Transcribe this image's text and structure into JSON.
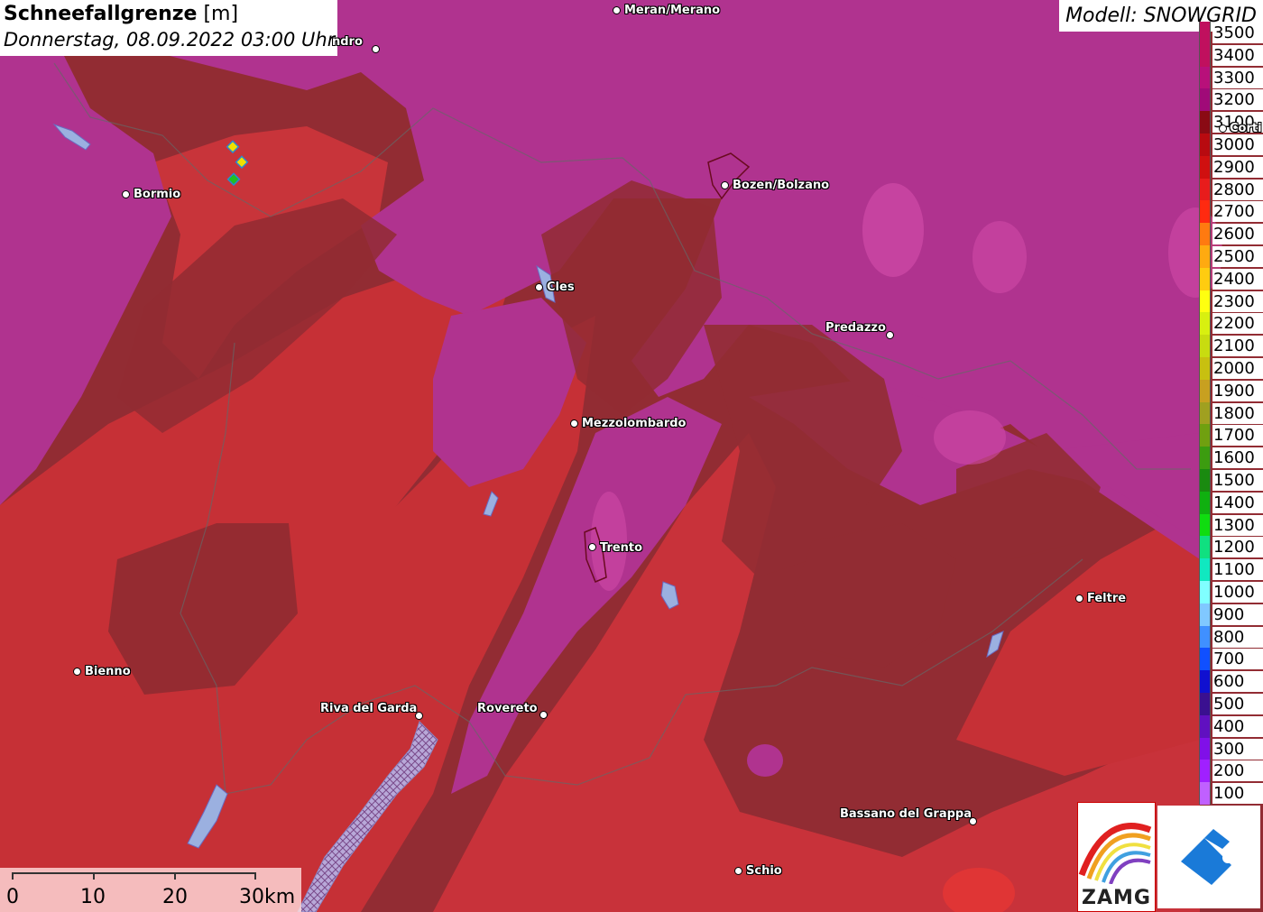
{
  "title": {
    "main": "Schneefallgrenze",
    "unit": "[m]",
    "datetime": "Donnerstag, 08.09.2022 03:00 Uhr"
  },
  "model": "Modell: SNOWGRID",
  "legend": [
    {
      "label": "3500",
      "color": "#c0105e"
    },
    {
      "label": "3400",
      "color": "#c0105e"
    },
    {
      "label": "3300",
      "color": "#b8107a"
    },
    {
      "label": "3200",
      "color": "#a00a78"
    },
    {
      "label": "3100",
      "color": "#8a0a14"
    },
    {
      "label": "3000",
      "color": "#b80a10"
    },
    {
      "label": "2900",
      "color": "#d01010"
    },
    {
      "label": "2800",
      "color": "#e81c1c"
    },
    {
      "label": "2700",
      "color": "#ff2a10"
    },
    {
      "label": "2600",
      "color": "#ff7a10"
    },
    {
      "label": "2500",
      "color": "#ffaa10"
    },
    {
      "label": "2400",
      "color": "#ffcc10"
    },
    {
      "label": "2300",
      "color": "#ffff10"
    },
    {
      "label": "2200",
      "color": "#d8f010"
    },
    {
      "label": "2100",
      "color": "#c8dc10"
    },
    {
      "label": "2000",
      "color": "#c8c010"
    },
    {
      "label": "1900",
      "color": "#c8a020"
    },
    {
      "label": "1800",
      "color": "#a0a020"
    },
    {
      "label": "1700",
      "color": "#70a010"
    },
    {
      "label": "1600",
      "color": "#3c9c10"
    },
    {
      "label": "1500",
      "color": "#1a8a10"
    },
    {
      "label": "1400",
      "color": "#10b010"
    },
    {
      "label": "1300",
      "color": "#10dc10"
    },
    {
      "label": "1200",
      "color": "#10e080"
    },
    {
      "label": "1100",
      "color": "#10e8c0"
    },
    {
      "label": "1000",
      "color": "#80ffff"
    },
    {
      "label": "900",
      "color": "#80c8ff"
    },
    {
      "label": "800",
      "color": "#4090ff"
    },
    {
      "label": "700",
      "color": "#1050ff"
    },
    {
      "label": "600",
      "color": "#1010d0"
    },
    {
      "label": "500",
      "color": "#3a1090"
    },
    {
      "label": "400",
      "color": "#6010c0"
    },
    {
      "label": "300",
      "color": "#8010e8"
    },
    {
      "label": "200",
      "color": "#a020ff"
    },
    {
      "label": "100",
      "color": "#c060ff"
    }
  ],
  "cities": [
    {
      "name": "Meran/Merano",
      "label_side": "right"
    },
    {
      "name": "ndro",
      "label_side": "left"
    },
    {
      "name": "Bozen/Bolzano",
      "label_side": "right"
    },
    {
      "name": "Bormio",
      "label_side": "right"
    },
    {
      "name": "Cles",
      "label_side": "right"
    },
    {
      "name": "Predazzo",
      "label_side": "left"
    },
    {
      "name": "Mezzolombardo",
      "label_side": "right"
    },
    {
      "name": "Trento",
      "label_side": "right"
    },
    {
      "name": "Feltre",
      "label_side": "right"
    },
    {
      "name": "Bienno",
      "label_side": "right"
    },
    {
      "name": "Riva del Garda",
      "label_side": "left"
    },
    {
      "name": "Rovereto",
      "label_side": "left"
    },
    {
      "name": "Bassano del Grappa",
      "label_side": "left"
    },
    {
      "name": "Schio",
      "label_side": "right"
    },
    {
      "name": "Corti",
      "label_side": "right"
    }
  ],
  "scale": {
    "labels": [
      "0",
      "10",
      "20",
      "30km"
    ]
  },
  "logos": {
    "zamg_text": "ZAMG"
  },
  "colors": {
    "magenta_zone": "#b0338f",
    "dark_red_zone": "#8f2a2c",
    "red_zone": "#c8303a",
    "lake": "#9bb0e0"
  }
}
